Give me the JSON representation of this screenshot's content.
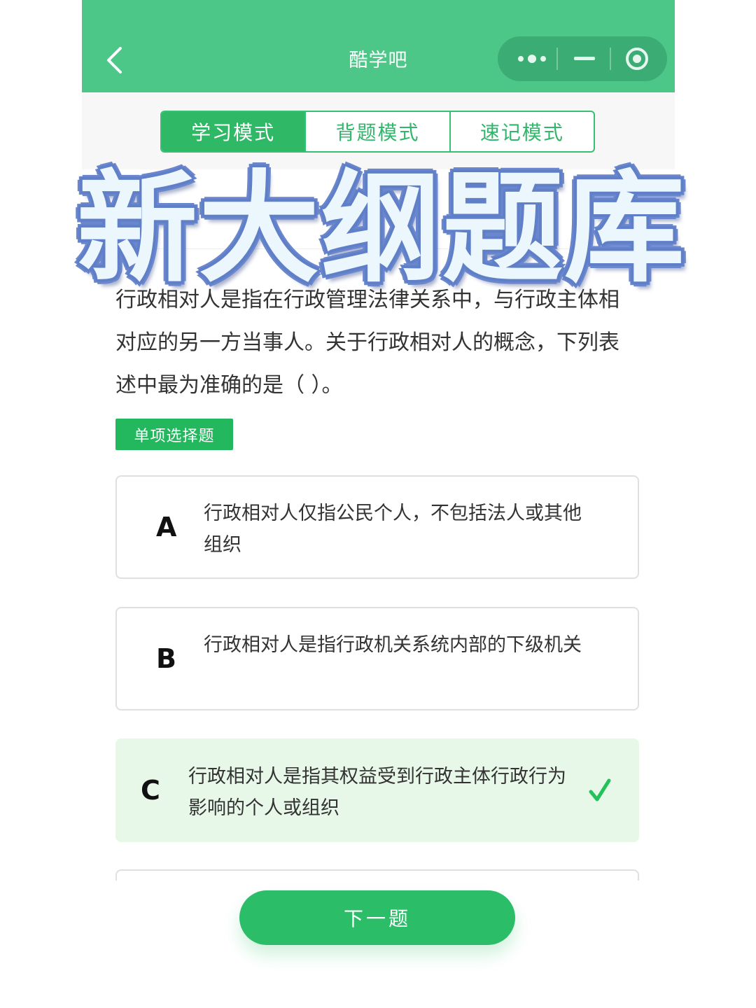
{
  "nav": {
    "title": "酷学吧",
    "back_icon": "chevron-left-icon",
    "capsule": {
      "more_icon": "more-dots-icon",
      "minimize_icon": "minus-icon",
      "close_icon": "target-icon"
    }
  },
  "tabs": [
    {
      "label": "学习模式",
      "active": true
    },
    {
      "label": "背题模式",
      "active": false
    },
    {
      "label": "速记模式",
      "active": false
    }
  ],
  "overlay_title": "新大纲题库",
  "question": {
    "text": "行政相对人是指在行政管理法律关系中，与行政主体相对应的另一方当事人。关于行政相对人的概念，下列表述中最为准确的是（ ）。",
    "type_label": "单项选择题"
  },
  "options": [
    {
      "letter": "A",
      "text": "行政相对人仅指公民个人，不包括法人或其他组织",
      "correct": false
    },
    {
      "letter": "B",
      "text": "行政相对人是指行政机关系统内部的下级机关",
      "correct": false
    },
    {
      "letter": "C",
      "text": "行政相对人是指其权益受到行政主体行政行为影响的个人或组织",
      "correct": true
    }
  ],
  "next_button": {
    "label": "下一题"
  },
  "colors": {
    "header": "#4cc788",
    "accent": "#2fb866",
    "correct_bg": "#e8f8e8",
    "check": "#21c25a"
  }
}
